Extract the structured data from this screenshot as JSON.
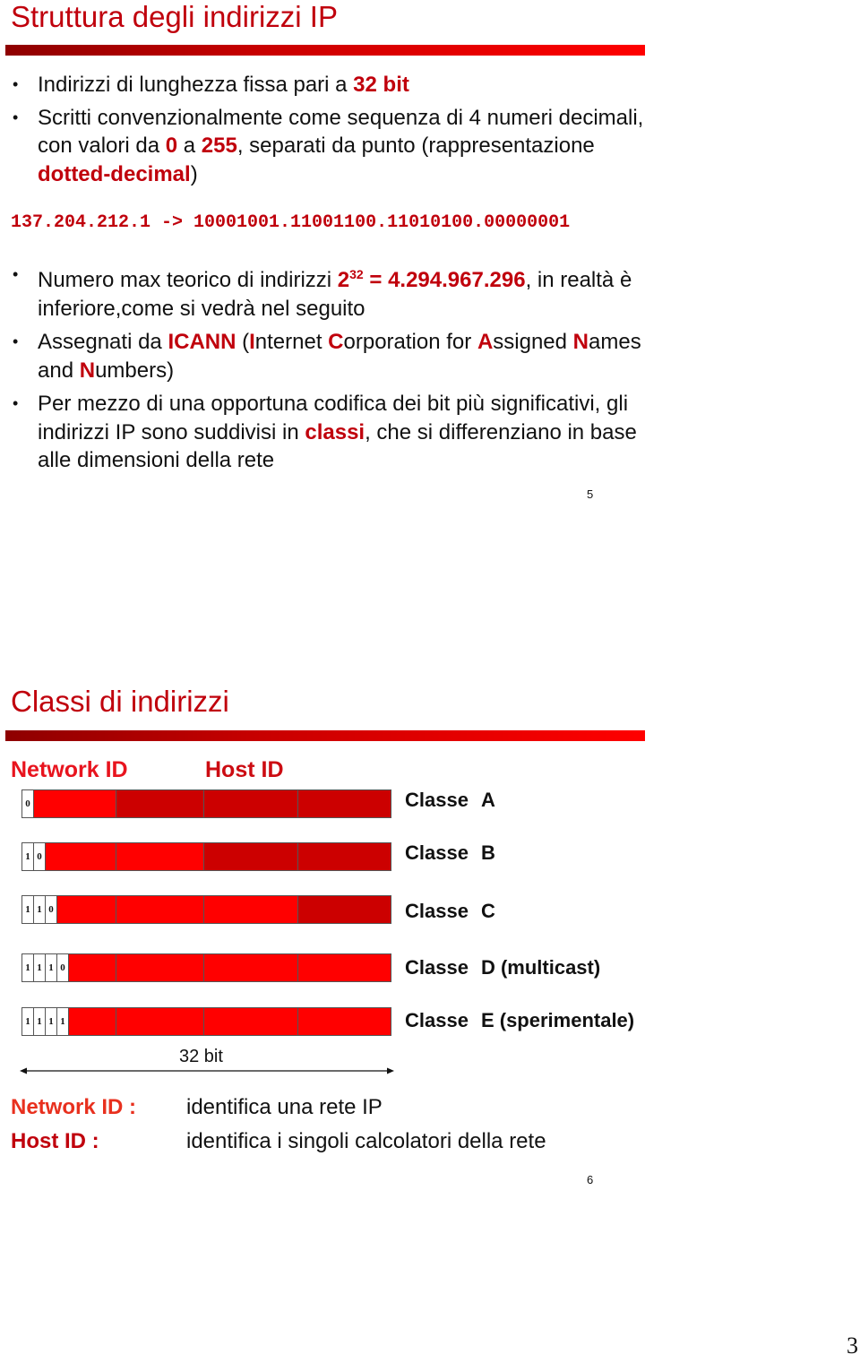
{
  "slide1": {
    "title": "Struttura degli indirizzi IP",
    "bullets": {
      "b1": {
        "text": "Indirizzi di lunghezza fissa pari a ",
        "hl": "32 bit"
      },
      "b2": {
        "t1": "Scritti convenzionalmente come sequenza di 4 numeri decimali, con valori da ",
        "h1": "0",
        "t2": " a ",
        "h2": "255",
        "t3": ", separati da punto (rappresentazione ",
        "h3": "dotted-decimal",
        "t4": ")"
      },
      "example": "137.204.212.1 -> 10001001.11001100.11010100.00000001",
      "b3": {
        "t1": "Numero max teorico di indirizzi ",
        "base": "2",
        "exp": "32",
        "h_value": " = 4.294.967.296",
        "t2": ", in realtà è inferiore,come si vedrà nel seguito"
      },
      "b4": {
        "t1": "Assegnati da ",
        "h1": "ICANN",
        "t2": " (",
        "i": "I",
        "t3": "nternet ",
        "c": "C",
        "t4": "orporation for ",
        "a": "A",
        "t5": "ssigned ",
        "n1": "N",
        "t6": "ames and ",
        "n2": "N",
        "t7": "umbers)"
      },
      "b5": {
        "t1": "Per mezzo di una opportuna codifica dei bit più significativi, gli indirizzi IP sono suddivisi in ",
        "h1": "classi",
        "t2": ", che si differenziano in base alle dimensioni della rete"
      }
    },
    "page_number": "5"
  },
  "slide2": {
    "title": "Classi di indirizzi",
    "network_id_label": "Network ID",
    "host_id_label": "Host ID",
    "classes": [
      {
        "prefix": [
          "0"
        ],
        "network_octets": 1,
        "label": "Classe",
        "letter": "A"
      },
      {
        "prefix": [
          "1",
          "0"
        ],
        "network_octets": 2,
        "label": "Classe",
        "letter": "B"
      },
      {
        "prefix": [
          "1",
          "1",
          "0"
        ],
        "network_octets": 3,
        "label": "Classe",
        "letter": "C"
      },
      {
        "prefix": [
          "1",
          "1",
          "1",
          "0"
        ],
        "network_octets": 4,
        "label": "Classe",
        "letter": "D (multicast)"
      },
      {
        "prefix": [
          "1",
          "1",
          "1",
          "1"
        ],
        "network_octets": 4,
        "label": "Classe",
        "letter": "E (sperimentale)"
      }
    ],
    "width_label": "32 bit",
    "legend": {
      "network_key": "Network ID :",
      "network_value": "identifica una rete IP",
      "host_key": "Host ID :",
      "host_value": "identifica i singoli calcolatori della rete"
    },
    "page_number": "6"
  },
  "colors": {
    "accent": "#c0000c",
    "diagram_label": "#e8141e",
    "network_fill": "#ff0000",
    "host_fill": "#cc0000"
  },
  "document_page_number": "3"
}
